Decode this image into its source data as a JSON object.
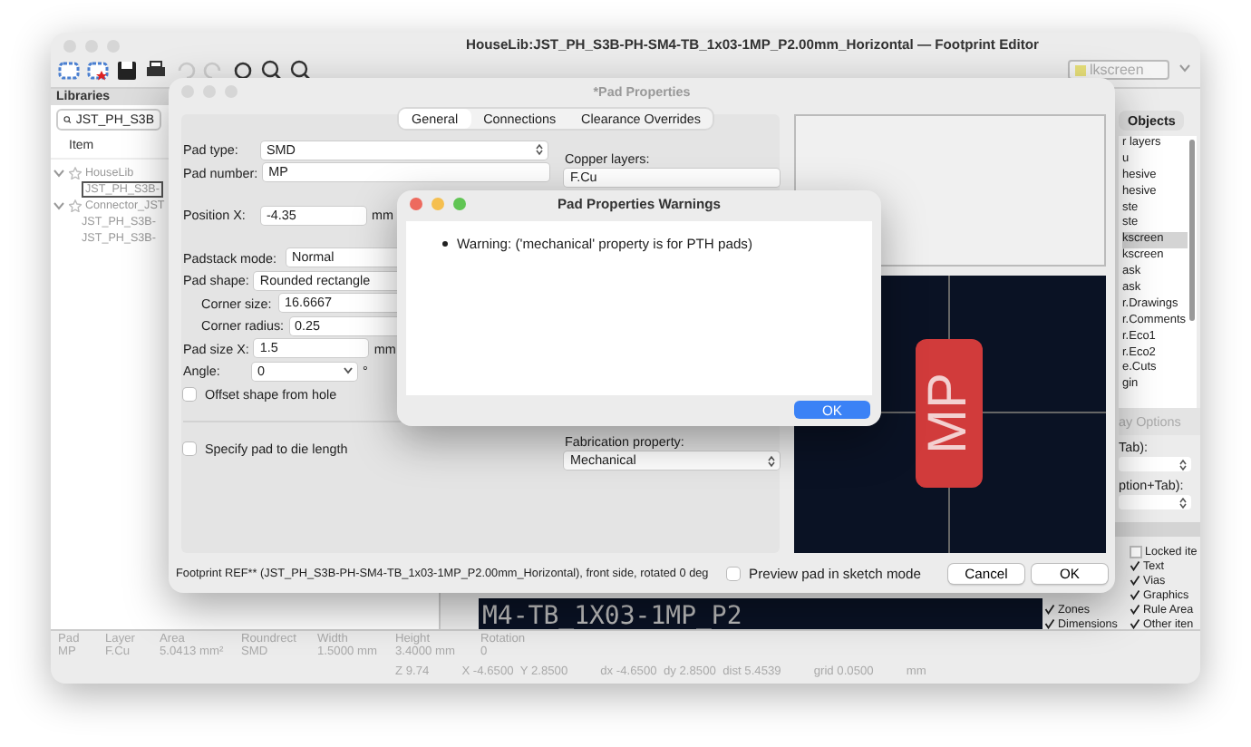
{
  "main_window": {
    "title": "HouseLib:JST_PH_S3B-PH-SM4-TB_1x03-1MP_P2.00mm_Horizontal — Footprint Editor",
    "layer_dropdown": "lkscreen",
    "canvas_text": "M4-TB_1X03-1MP_P2"
  },
  "libraries": {
    "title": "Libraries",
    "search": "JST_PH_S3B",
    "column": "Item",
    "tree": [
      {
        "label": "HouseLib",
        "expanded": true,
        "selected": false,
        "children": [
          {
            "label": "JST_PH_S3B-",
            "selected": true
          }
        ]
      },
      {
        "label": "Connector_JST",
        "expanded": true,
        "selected": false,
        "children": [
          {
            "label": "JST_PH_S3B-",
            "selected": false
          },
          {
            "label": "JST_PH_S3B-",
            "selected": false
          }
        ]
      }
    ]
  },
  "appearance": {
    "tab": "Objects",
    "layers": [
      {
        "label": "r layers",
        "selected": false
      },
      {
        "label": "u",
        "selected": false
      },
      {
        "label": "hesive",
        "selected": false
      },
      {
        "label": "hesive",
        "selected": false
      },
      {
        "label": "ste",
        "selected": false
      },
      {
        "label": "ste",
        "selected": false
      },
      {
        "label": "kscreen",
        "selected": true
      },
      {
        "label": "kscreen",
        "selected": false
      },
      {
        "label": "ask",
        "selected": false
      },
      {
        "label": "ask",
        "selected": false
      },
      {
        "label": "r.Drawings",
        "selected": false
      },
      {
        "label": "r.Comments",
        "selected": false
      },
      {
        "label": "r.Eco1",
        "selected": false
      },
      {
        "label": "r.Eco2",
        "selected": false
      },
      {
        "label": "e.Cuts",
        "selected": false
      },
      {
        "label": "gin",
        "selected": false
      }
    ],
    "display_options": "ay Options",
    "preset_labels": [
      "Tab):",
      "ption+Tab):"
    ],
    "objects_left": [
      {
        "label": "Zones",
        "checked": true
      },
      {
        "label": "Dimensions",
        "checked": true
      }
    ],
    "objects_right": [
      {
        "label": "Locked ite",
        "checked": false
      },
      {
        "label": "Text",
        "checked": true
      },
      {
        "label": "Vias",
        "checked": true
      },
      {
        "label": "Graphics",
        "checked": true
      },
      {
        "label": "Rule Area",
        "checked": true
      },
      {
        "label": "Other iten",
        "checked": true
      }
    ]
  },
  "message_panel": [
    {
      "label": "Pad",
      "value": "MP"
    },
    {
      "label": "Layer",
      "value": "F.Cu"
    },
    {
      "label": "Area",
      "value": "5.0413 mm²"
    },
    {
      "label": "Roundrect",
      "value": "SMD"
    },
    {
      "label": "Width",
      "value": "1.5000 mm"
    },
    {
      "label": "Height",
      "value": "3.4000 mm"
    },
    {
      "label": "Rotation",
      "value": "0"
    }
  ],
  "status_bar": [
    "Z 9.74",
    "X -4.6500  Y 2.8500",
    "dx -4.6500  dy 2.8500  dist 5.4539",
    "grid 0.0500",
    "mm"
  ],
  "pad_dialog": {
    "title": "*Pad Properties",
    "tabs": [
      {
        "label": "General",
        "selected": true
      },
      {
        "label": "Connections",
        "selected": false
      },
      {
        "label": "Clearance Overrides",
        "selected": false
      }
    ],
    "fields": [
      {
        "kind": "select",
        "label": "Pad type:",
        "value": "SMD"
      },
      {
        "kind": "input",
        "label": "Pad number:",
        "value": "MP"
      },
      {
        "kind": "gap"
      },
      {
        "kind": "input",
        "label": "Position X:",
        "value": "-4.35",
        "unit": "mm"
      },
      {
        "kind": "gap"
      },
      {
        "kind": "select",
        "label": "Padstack mode:",
        "value": "Normal"
      },
      {
        "kind": "select",
        "label": "Pad shape:",
        "value": "Rounded rectangle"
      },
      {
        "kind": "subinput",
        "label": "Corner size:",
        "value": "16.6667"
      },
      {
        "kind": "subinput",
        "label": "Corner radius:",
        "value": "0.25"
      },
      {
        "kind": "input",
        "label": "Pad size X:",
        "value": "1.5",
        "unit": "mm"
      },
      {
        "kind": "combo",
        "label": "Angle:",
        "value": "0",
        "unit": "°"
      },
      {
        "kind": "checkbox",
        "label": "Offset shape from hole",
        "checked": false
      },
      {
        "kind": "divider"
      },
      {
        "kind": "checkbox",
        "label": "Specify pad to die length",
        "checked": false
      }
    ],
    "copper_layers": {
      "label": "Copper layers:",
      "value": "F.Cu"
    },
    "fabrication": {
      "label": "Fabrication property:",
      "value": "Mechanical"
    },
    "preview_pad": "MP",
    "footer_text": "Footprint REF** (JST_PH_S3B-PH-SM4-TB_1x03-1MP_P2.00mm_Horizontal), front side, rotated 0 deg",
    "sketch_mode": {
      "label": "Preview pad in sketch mode",
      "checked": false
    },
    "buttons": [
      "Cancel",
      "OK"
    ]
  },
  "warnings_dialog": {
    "title": "Pad Properties Warnings",
    "messages": [
      "Warning: ('mechanical' property is for PTH pads)"
    ],
    "button": "OK"
  }
}
